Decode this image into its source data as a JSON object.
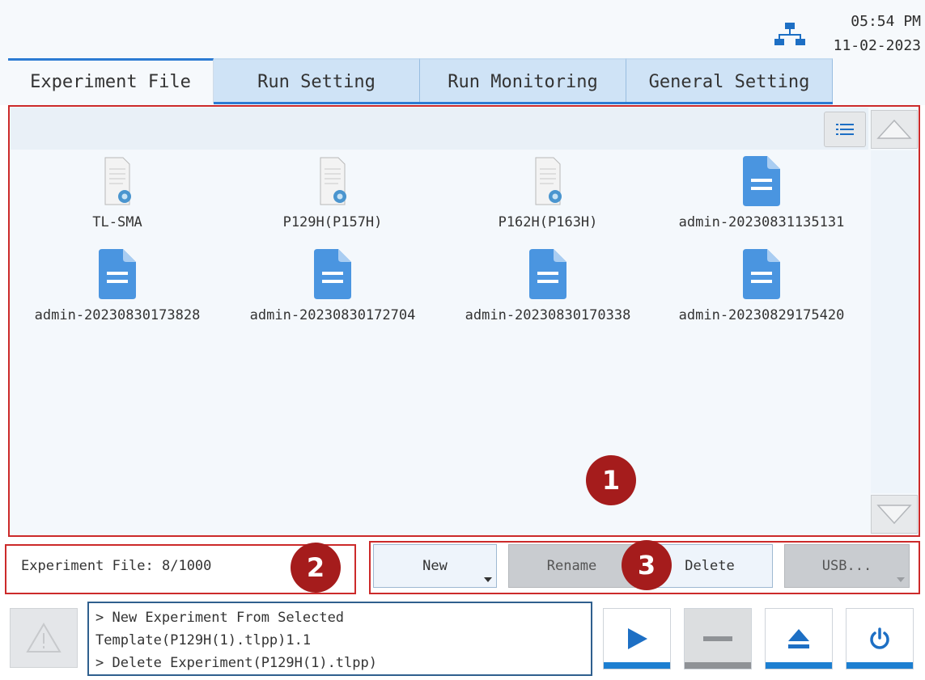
{
  "header": {
    "time": "05:54 PM",
    "date": "11-02-2023",
    "network_icon": "network-icon"
  },
  "tabs": [
    {
      "label": "Experiment File",
      "active": true
    },
    {
      "label": "Run Setting",
      "active": false
    },
    {
      "label": "Run Monitoring",
      "active": false
    },
    {
      "label": "General Setting",
      "active": false
    }
  ],
  "files": [
    {
      "name": "TL-SMA",
      "icon": "template-file-icon"
    },
    {
      "name": "P129H(P157H)",
      "icon": "template-file-icon"
    },
    {
      "name": "P162H(P163H)",
      "icon": "template-file-icon"
    },
    {
      "name": "admin-20230831135131",
      "icon": "document-icon"
    },
    {
      "name": "admin-20230830173828",
      "icon": "document-icon"
    },
    {
      "name": "admin-20230830172704",
      "icon": "document-icon"
    },
    {
      "name": "admin-20230830170338",
      "icon": "document-icon"
    },
    {
      "name": "admin-20230829175420",
      "icon": "document-icon"
    }
  ],
  "callouts": [
    "1",
    "2",
    "3"
  ],
  "status": {
    "label": "Experiment File: 8/1000"
  },
  "actions": {
    "new": "New",
    "rename": "Rename",
    "delete": "Delete",
    "usb": "USB..."
  },
  "log": [
    "> New Experiment From Selected",
    "Template(P129H(1).tlpp)1.1",
    "> Delete Experiment(P129H(1).tlpp)"
  ],
  "controls": [
    "play-icon",
    "stop-icon",
    "eject-icon",
    "power-icon"
  ],
  "colors": {
    "accent": "#1d7fd1",
    "tab_inactive": "#cfe3f6",
    "callout": "#a51c1c",
    "highlight_border": "#cc2a2a"
  }
}
